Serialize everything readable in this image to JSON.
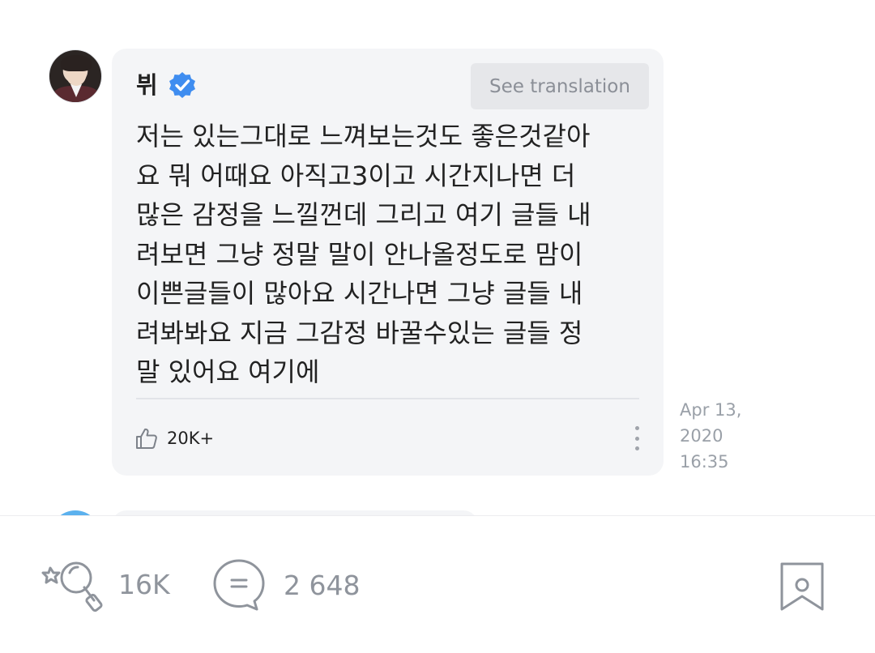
{
  "post": {
    "author_name": "뷔",
    "verified_icon": "verified-badge-icon",
    "translate_label": "See translation",
    "text": "저는 있는그대로 느껴보는것도 좋은것같아\n요 뭐 어때요 아직고3이고 시간지나면 더\n많은 감정을 느낄껀데 그리고 여기 글들 내\n려보면 그냥 정말 말이 안나올정도로 맘이\n이쁜글들이 많아요 시간나면 그냥 글들 내\n려봐봐요 지금 그감정 바꿀수있는 글들 정\n말 있어요 여기에",
    "like_count": "20K+",
    "timestamp_date": "Apr 13,",
    "timestamp_year": "2020",
    "timestamp_time": "16:35"
  },
  "bottom_bar": {
    "lightstick_count": "16K",
    "comment_count": "2 648"
  },
  "colors": {
    "card_bg": "#f4f5f7",
    "verified": "#3f8df0",
    "muted": "#8f949c"
  }
}
